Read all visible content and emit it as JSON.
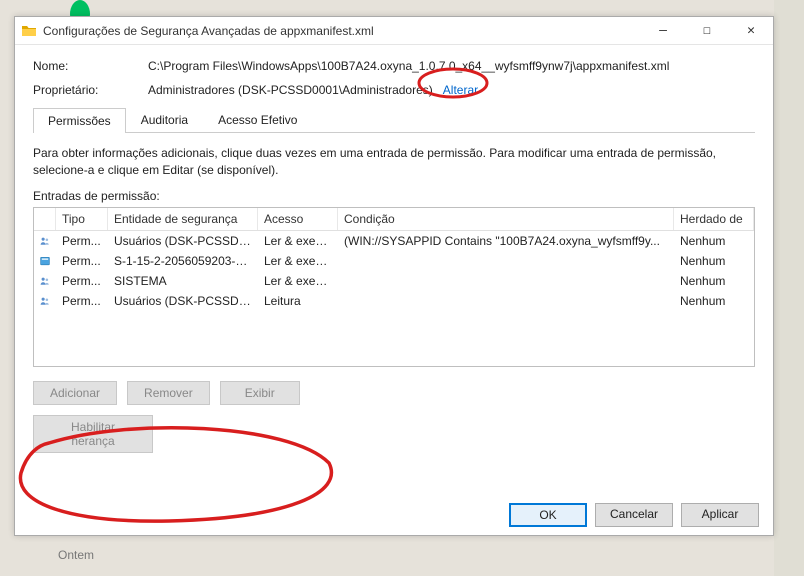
{
  "titlebar": {
    "title": "Configurações de Segurança Avançadas de appxmanifest.xml"
  },
  "props": {
    "name_label": "Nome:",
    "name_value": "C:\\Program Files\\WindowsApps\\100B7A24.oxyna_1.0.7.0_x64__wyfsmff9ynw7j\\appxmanifest.xml",
    "owner_label": "Proprietário:",
    "owner_value": "Administradores (DSK-PCSSD0001\\Administradores)",
    "change_link": "Alterar"
  },
  "tabs": {
    "t1": "Permissões",
    "t2": "Auditoria",
    "t3": "Acesso Efetivo"
  },
  "body": {
    "desc": "Para obter informações adicionais, clique duas vezes em uma entrada de permissão. Para modificar uma entrada de permissão, selecione-a e clique em Editar (se disponível).",
    "entries_label": "Entradas de permissão:"
  },
  "columns": {
    "type": "Tipo",
    "entity": "Entidade de segurança",
    "access": "Acesso",
    "cond": "Condição",
    "inherit": "Herdado de"
  },
  "rows": [
    {
      "icon": "users",
      "type": "Perm...",
      "entity": "Usuários (DSK-PCSSD0...",
      "access": "Ler & execu...",
      "cond": "(WIN://SYSAPPID Contains \"100B7A24.oxyna_wyfsmff9y...",
      "inherit": "Nenhum"
    },
    {
      "icon": "app",
      "type": "Perm...",
      "entity": "S-1-15-2-2056059203-1...",
      "access": "Ler & execu...",
      "cond": "",
      "inherit": "Nenhum"
    },
    {
      "icon": "users",
      "type": "Perm...",
      "entity": "SISTEMA",
      "access": "Ler & execu...",
      "cond": "",
      "inherit": "Nenhum"
    },
    {
      "icon": "users",
      "type": "Perm...",
      "entity": "Usuários (DSK-PCSSD0...",
      "access": "Leitura",
      "cond": "",
      "inherit": "Nenhum"
    }
  ],
  "buttons": {
    "add": "Adicionar",
    "remove": "Remover",
    "view": "Exibir",
    "enable": "Habilitar herança"
  },
  "footer": {
    "ok": "OK",
    "cancel": "Cancelar",
    "apply": "Aplicar"
  },
  "bg": {
    "ontem": "Ontem"
  }
}
